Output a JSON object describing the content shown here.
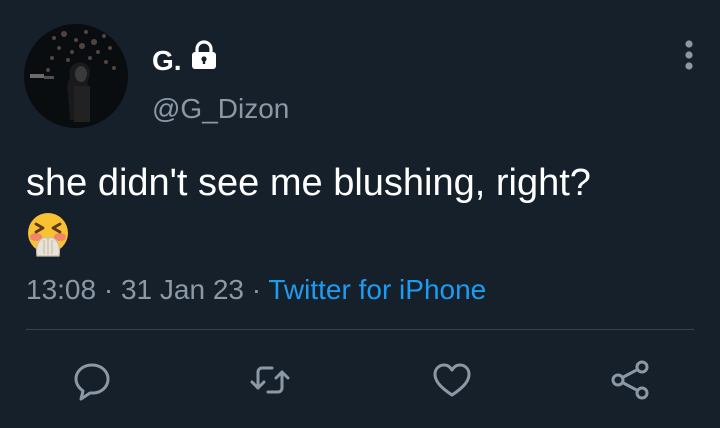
{
  "tweet": {
    "author": {
      "display_name": "G.",
      "handle": "@G_Dizon",
      "protected": true
    },
    "text": "she didn't see me blushing, right?",
    "emoji": "face-with-hand-over-mouth-blushing",
    "time": "13:08",
    "separator": "·",
    "date": "31 Jan 23",
    "source": "Twitter for iPhone"
  },
  "icons": {
    "more": "vertical-ellipsis-icon",
    "actions": [
      "reply-icon",
      "retweet-icon",
      "like-icon",
      "share-icon"
    ]
  },
  "colors": {
    "background": "#15202b",
    "text": "#ffffff",
    "secondary": "#8b98a5",
    "link": "#1d9bf0",
    "divider": "#38444d"
  }
}
